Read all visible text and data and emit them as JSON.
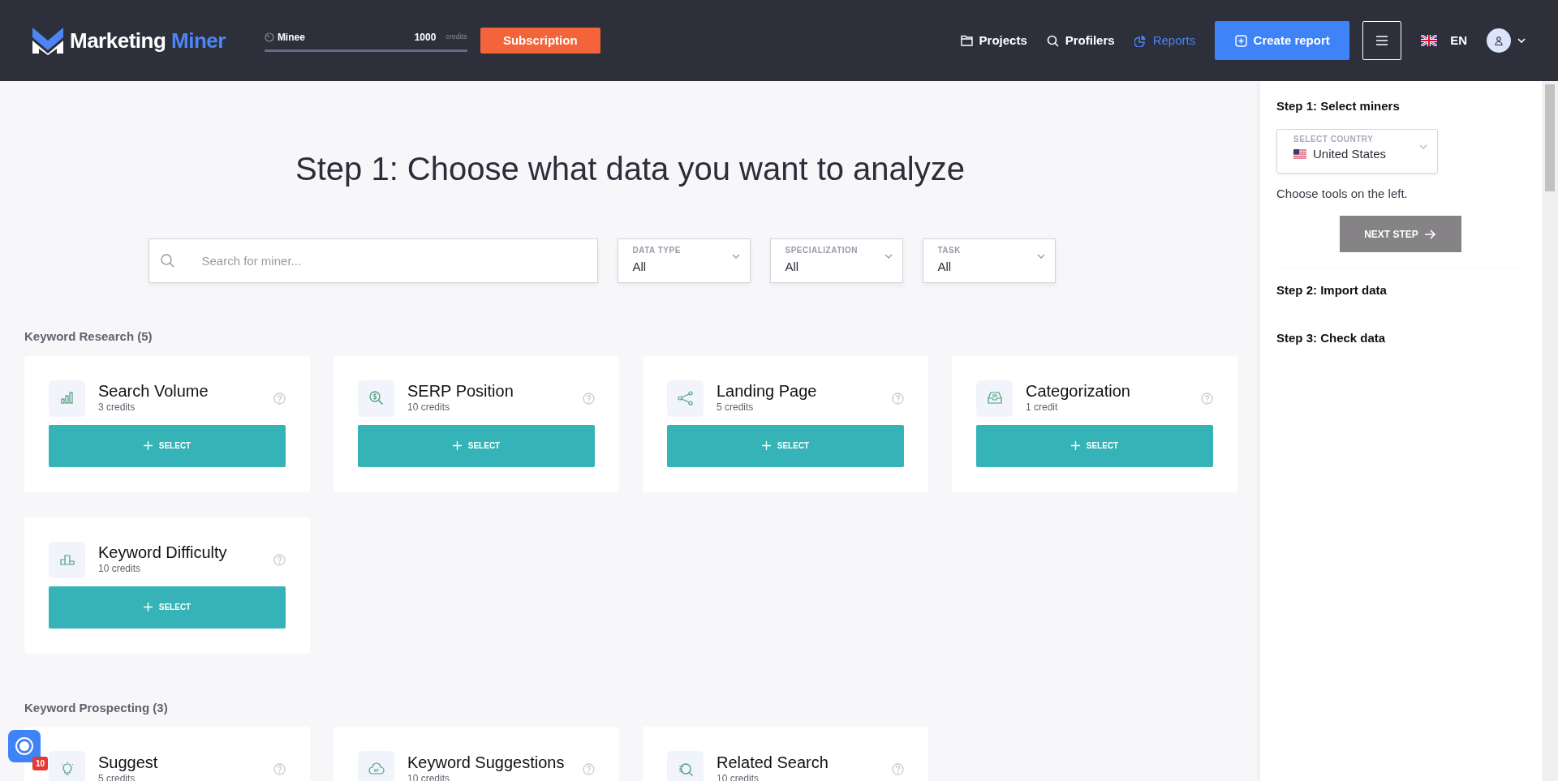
{
  "header": {
    "logo": {
      "first": "Marketing",
      "second": "Miner"
    },
    "account": {
      "name": "Minee",
      "amount": "1000",
      "unit": "credits",
      "level": 1
    },
    "subscription_button": "Subscription",
    "nav": [
      {
        "label": "Projects",
        "selected": false
      },
      {
        "label": "Profilers",
        "selected": false
      },
      {
        "label": "Reports",
        "selected": true
      }
    ],
    "create_button": "Create report",
    "language": "EN"
  },
  "main": {
    "title": "Step 1: Choose what data you want to analyze",
    "search": {
      "placeholder": "Search for miner..."
    },
    "filters": [
      {
        "label": "DATA TYPE",
        "value": "All"
      },
      {
        "label": "SPECIALIZATION",
        "value": "All"
      },
      {
        "label": "TASK",
        "value": "All"
      }
    ],
    "sections": [
      {
        "title": "Keyword Research (5)",
        "miners": [
          {
            "name": "Search Volume",
            "credits": "3 credits",
            "button": "SELECT"
          },
          {
            "name": "SERP Position",
            "credits": "10 credits",
            "button": "SELECT"
          },
          {
            "name": "Landing Page",
            "credits": "5 credits",
            "button": "SELECT"
          },
          {
            "name": "Categorization",
            "credits": "1 credit",
            "button": "SELECT"
          },
          {
            "name": "Keyword Difficulty",
            "credits": "10 credits",
            "button": "SELECT"
          }
        ]
      },
      {
        "title": "Keyword Prospecting (3)",
        "miners": [
          {
            "name": "Suggest",
            "credits": "5 credits"
          },
          {
            "name": "Keyword Suggestions",
            "credits": "10 credits"
          },
          {
            "name": "Related Search",
            "credits": "10 credits"
          }
        ]
      }
    ]
  },
  "sidebar": {
    "steps": [
      {
        "title": "Step 1: Select miners",
        "country": {
          "label": "SELECT COUNTRY",
          "value": "United States"
        },
        "hint": "Choose tools on the left.",
        "next_button": {
          "label": "NEXT STEP",
          "disabled": true
        }
      },
      {
        "title": "Step 2: Import data"
      },
      {
        "title": "Step 3: Check data"
      }
    ]
  },
  "chat_widget": {
    "badge": "10"
  }
}
